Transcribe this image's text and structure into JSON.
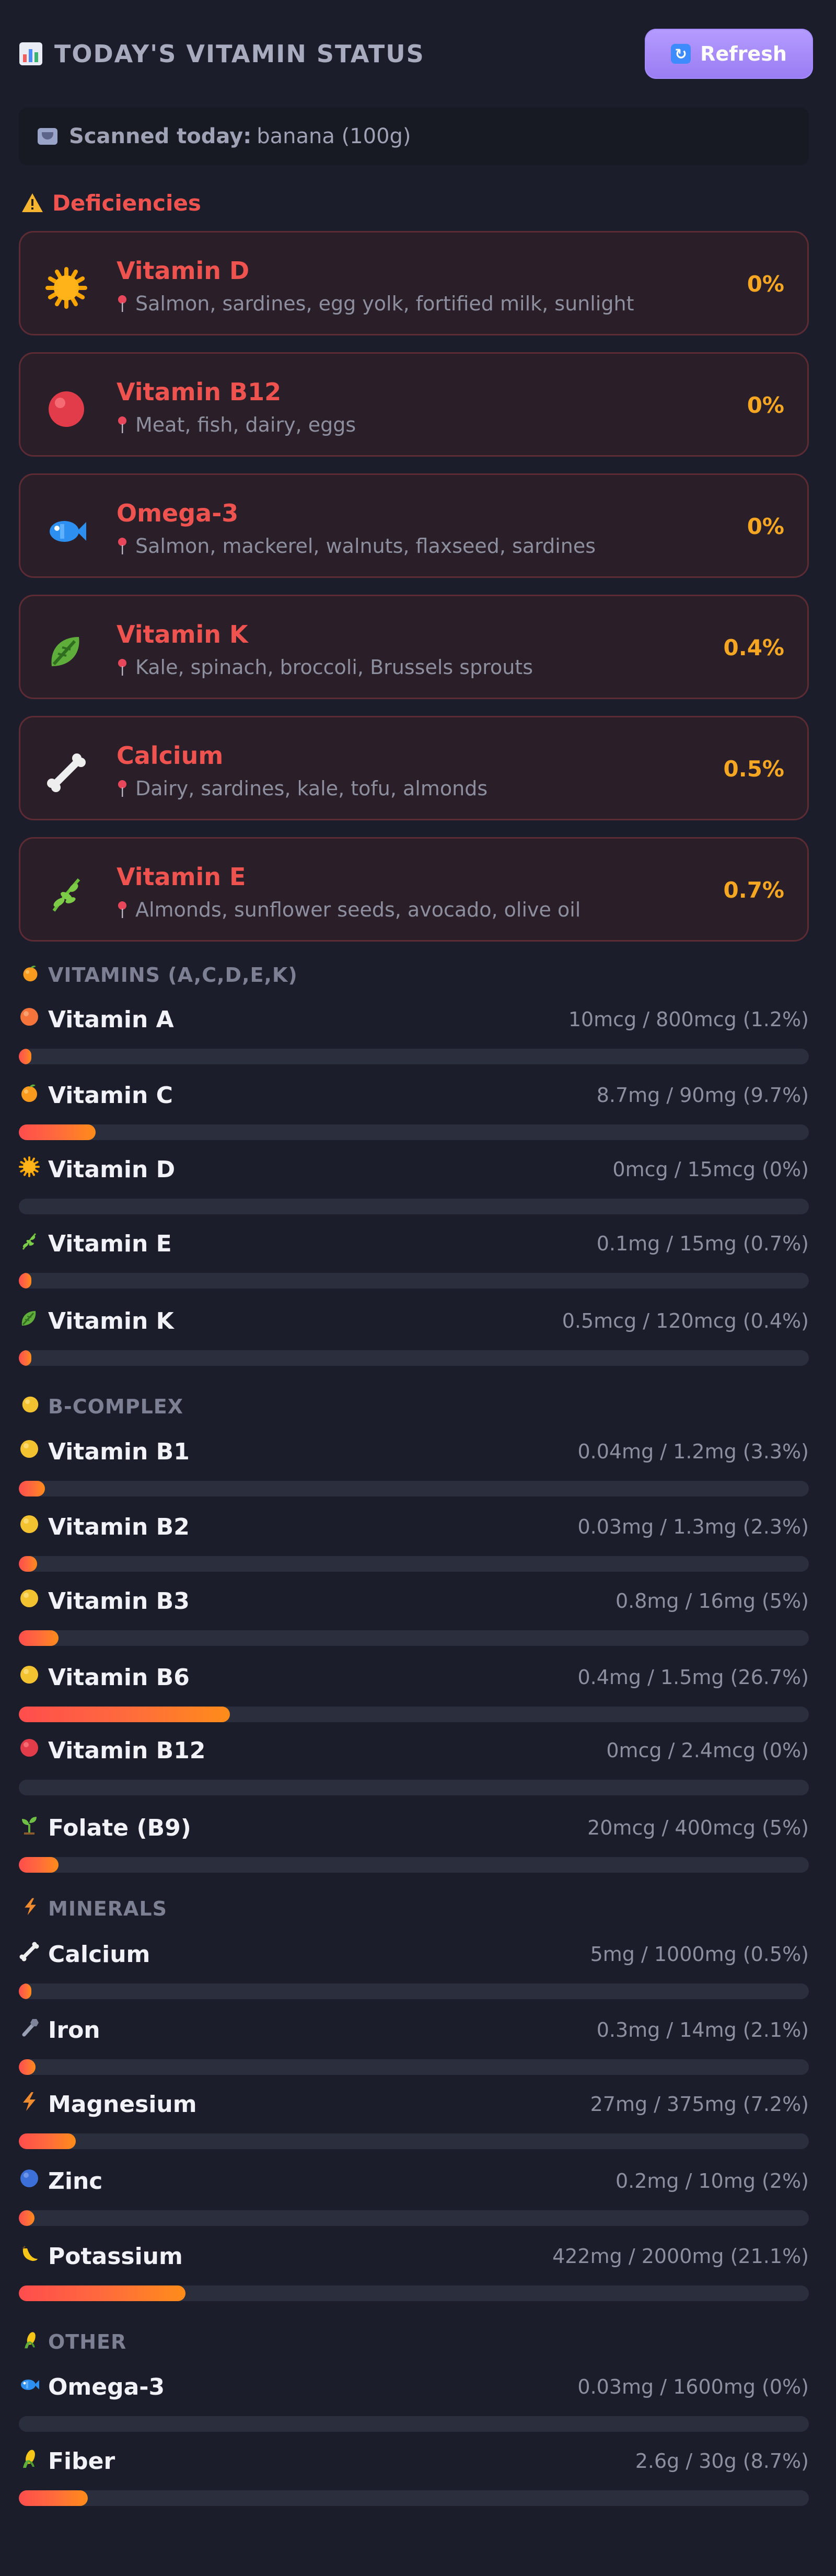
{
  "header": {
    "title": "TODAY'S VITAMIN STATUS",
    "refresh_label": "Refresh"
  },
  "scanned": {
    "label": "Scanned today:",
    "value": "banana (100g)"
  },
  "deficiencies": {
    "heading": "Deficiencies",
    "items": [
      {
        "name": "Vitamin D",
        "sources": "Salmon, sardines, egg yolk, fortified milk, sunlight",
        "percent": "0%",
        "icon": "sun-icon"
      },
      {
        "name": "Vitamin B12",
        "sources": "Meat, fish, dairy, eggs",
        "percent": "0%",
        "icon": "red-circle-icon"
      },
      {
        "name": "Omega-3",
        "sources": "Salmon, mackerel, walnuts, flaxseed, sardines",
        "percent": "0%",
        "icon": "fish-icon"
      },
      {
        "name": "Vitamin K",
        "sources": "Kale, spinach, broccoli, Brussels sprouts",
        "percent": "0.4%",
        "icon": "leafy-green-icon"
      },
      {
        "name": "Calcium",
        "sources": "Dairy, sardines, kale, tofu, almonds",
        "percent": "0.5%",
        "icon": "bone-icon"
      },
      {
        "name": "Vitamin E",
        "sources": "Almonds, sunflower seeds, avocado, olive oil",
        "percent": "0.7%",
        "icon": "herb-icon"
      }
    ]
  },
  "sections": [
    {
      "heading": "VITAMINS (A,C,D,E,K)",
      "icon": "tangerine-icon",
      "items": [
        {
          "name": "Vitamin A",
          "amount": "10mcg / 800mcg (1.2%)",
          "percent": 1.2,
          "icon": "orange-circle-icon"
        },
        {
          "name": "Vitamin C",
          "amount": "8.7mg / 90mg (9.7%)",
          "percent": 9.7,
          "icon": "tangerine-icon"
        },
        {
          "name": "Vitamin D",
          "amount": "0mcg / 15mcg (0%)",
          "percent": 0,
          "icon": "sun-icon"
        },
        {
          "name": "Vitamin E",
          "amount": "0.1mg / 15mg (0.7%)",
          "percent": 0.7,
          "icon": "herb-icon"
        },
        {
          "name": "Vitamin K",
          "amount": "0.5mcg / 120mcg (0.4%)",
          "percent": 0.4,
          "icon": "leafy-green-icon"
        }
      ]
    },
    {
      "heading": "B-COMPLEX",
      "icon": "yellow-circle-icon",
      "items": [
        {
          "name": "Vitamin B1",
          "amount": "0.04mg / 1.2mg (3.3%)",
          "percent": 3.3,
          "icon": "yellow-circle-icon"
        },
        {
          "name": "Vitamin B2",
          "amount": "0.03mg / 1.3mg (2.3%)",
          "percent": 2.3,
          "icon": "yellow-circle-icon"
        },
        {
          "name": "Vitamin B3",
          "amount": "0.8mg / 16mg (5%)",
          "percent": 5,
          "icon": "yellow-circle-icon"
        },
        {
          "name": "Vitamin B6",
          "amount": "0.4mg / 1.5mg (26.7%)",
          "percent": 26.7,
          "icon": "yellow-circle-icon"
        },
        {
          "name": "Vitamin B12",
          "amount": "0mcg / 2.4mcg (0%)",
          "percent": 0,
          "icon": "red-circle-icon"
        },
        {
          "name": "Folate (B9)",
          "amount": "20mcg / 400mcg (5%)",
          "percent": 5,
          "icon": "seedling-icon"
        }
      ]
    },
    {
      "heading": "MINERALS",
      "icon": "lightning-icon",
      "items": [
        {
          "name": "Calcium",
          "amount": "5mg / 1000mg (0.5%)",
          "percent": 0.5,
          "icon": "bone-icon"
        },
        {
          "name": "Iron",
          "amount": "0.3mg / 14mg (2.1%)",
          "percent": 2.1,
          "icon": "nut-bolt-icon"
        },
        {
          "name": "Magnesium",
          "amount": "27mg / 375mg (7.2%)",
          "percent": 7.2,
          "icon": "lightning-icon"
        },
        {
          "name": "Zinc",
          "amount": "0.2mg / 10mg (2%)",
          "percent": 2,
          "icon": "blue-circle-icon"
        },
        {
          "name": "Potassium",
          "amount": "422mg / 2000mg (21.1%)",
          "percent": 21.1,
          "icon": "banana-icon"
        }
      ]
    },
    {
      "heading": "OTHER",
      "icon": "corn-icon",
      "items": [
        {
          "name": "Omega-3",
          "amount": "0.03mg / 1600mg (0%)",
          "percent": 0,
          "icon": "fish-icon"
        },
        {
          "name": "Fiber",
          "amount": "2.6g / 30g (8.7%)",
          "percent": 8.7,
          "icon": "corn-icon"
        }
      ]
    }
  ],
  "colors": {
    "background": "#1b1d2a",
    "deficiency_red": "#ef5350",
    "percent_orange": "#f5a623",
    "button_purple": "#a58bff",
    "bar_gradient": [
      "#ff4d4d",
      "#ff8c1a"
    ]
  }
}
